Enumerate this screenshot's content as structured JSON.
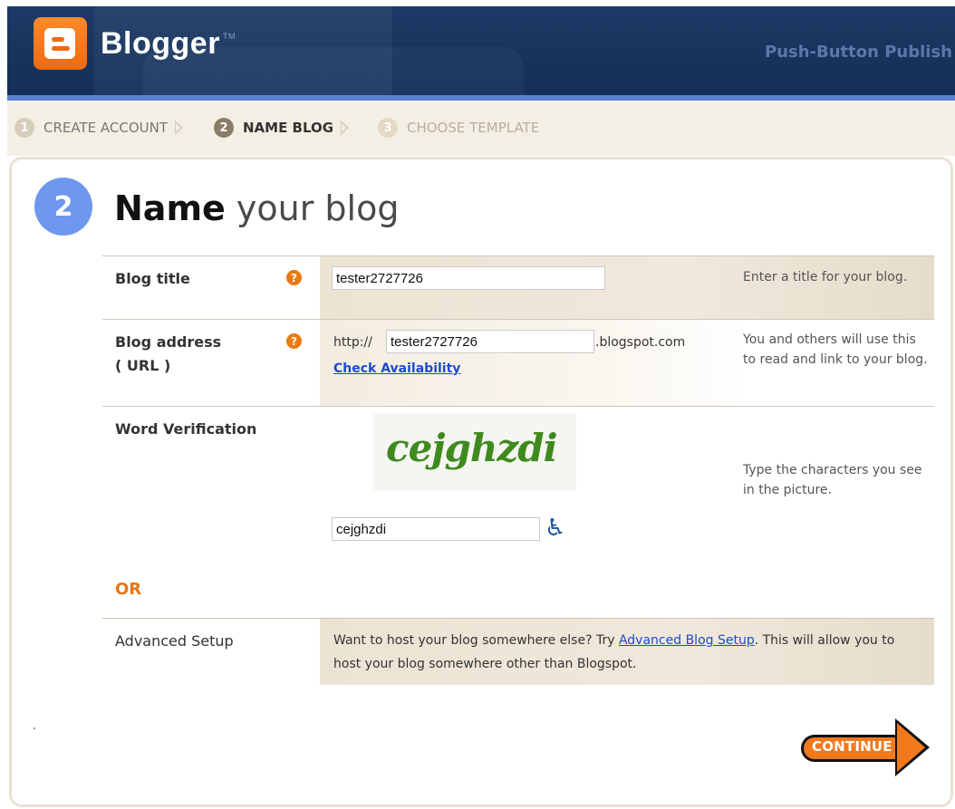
{
  "header": {
    "brand": "Blogger",
    "trademark": "TM",
    "slogan": "Push-Button Publish"
  },
  "steps": [
    {
      "num": "1",
      "label": "CREATE ACCOUNT",
      "state": "done"
    },
    {
      "num": "2",
      "label": "NAME BLOG",
      "state": "active"
    },
    {
      "num": "3",
      "label": "CHOOSE TEMPLATE",
      "state": "upcoming"
    }
  ],
  "page": {
    "step_number": "2",
    "title_bold": "Name",
    "title_rest": " your blog"
  },
  "form": {
    "blog_title": {
      "label": "Blog title",
      "value": "tester2727726",
      "help": "Enter a title for your blog."
    },
    "blog_address": {
      "label_line1": "Blog address",
      "label_line2": "( URL )",
      "prefix": "http://",
      "value": "tester2727726",
      "suffix": ".blogspot.com",
      "check_link": "Check Availability",
      "help": "You and others will use this to read and link to your blog."
    },
    "word_verification": {
      "label": "Word Verification",
      "captcha_text": "cejghzdi",
      "value": "cejghzdi",
      "help": "Type the characters you see in the picture."
    },
    "or_label": "OR",
    "advanced": {
      "label": "Advanced Setup",
      "text_before": "Want to host your blog somewhere else? Try ",
      "link": "Advanced Blog Setup",
      "text_after": ". This will allow you to host your blog somewhere other than Blogspot."
    }
  },
  "continue_label": "CONTINUE",
  "colors": {
    "header_bg": "#16335c",
    "accent_orange": "#f27a1d",
    "step_blue": "#6e97f0",
    "link_blue": "#1a4bd1"
  }
}
